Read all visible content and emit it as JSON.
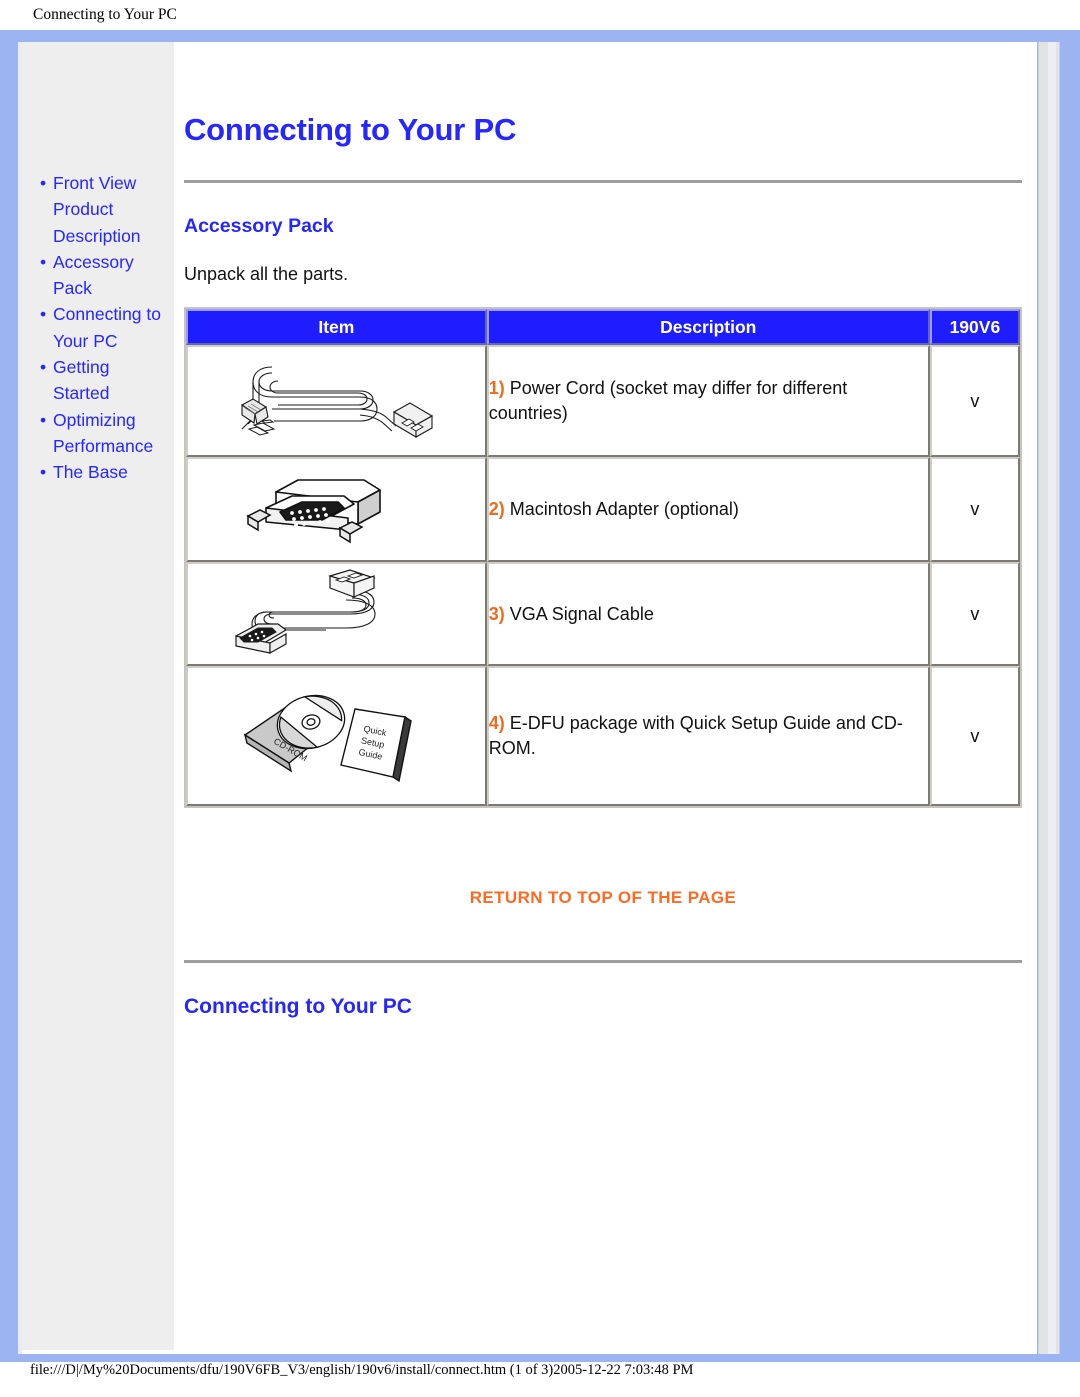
{
  "print_header": "Connecting to Your PC",
  "print_footer": "file:///D|/My%20Documents/dfu/190V6FB_V3/english/190v6/install/connect.htm (1 of 3)2005-12-22 7:03:48 PM",
  "colors": {
    "frame_blue": "#9cb5f2",
    "link_blue": "#2626ff",
    "header_blue": "#1d1dff",
    "accent_orange": "#f26b1d",
    "return_orange": "#ff6a22",
    "sidebar_gray": "#eeeeee"
  },
  "sidebar": {
    "items": [
      {
        "label": "Front View Product Description"
      },
      {
        "label": "Accessory Pack"
      },
      {
        "label": "Connecting to Your PC"
      },
      {
        "label": "Getting Started"
      },
      {
        "label": "Optimizing Performance"
      },
      {
        "label": "The Base"
      }
    ]
  },
  "main": {
    "page_title": "Connecting to Your PC",
    "section_accessory": {
      "title": "Accessory Pack",
      "intro": "Unpack all the parts."
    },
    "table": {
      "headers": {
        "item": "Item",
        "description": "Description",
        "model": "190V6"
      },
      "rows": [
        {
          "icon": "power-cord-illustration",
          "number": "1)",
          "description": "Power Cord (socket may differ for different countries)",
          "model": "v"
        },
        {
          "icon": "macintosh-adapter-illustration",
          "number": "2)",
          "description": "Macintosh Adapter (optional)",
          "model": "v"
        },
        {
          "icon": "vga-cable-illustration",
          "number": "3)",
          "description": "VGA Signal Cable",
          "model": "v"
        },
        {
          "icon": "cdrom-package-illustration",
          "number": "4)",
          "description": "E-DFU package with Quick Setup Guide and CD-ROM.",
          "model": "v"
        }
      ]
    },
    "return_to_top": "RETURN TO TOP OF THE PAGE",
    "section_connecting": {
      "title": "Connecting to Your PC"
    },
    "illustration_labels": {
      "cdrom": "CD-ROM",
      "quick": "Quick",
      "setup": "Setup",
      "guide": "Guide"
    }
  }
}
